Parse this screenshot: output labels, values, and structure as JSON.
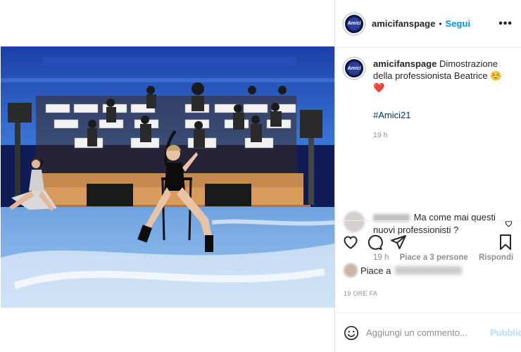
{
  "post": {
    "username": "amicifanspage",
    "follow_label": "Segui",
    "more_label": "•••",
    "avatar_text": "Amici"
  },
  "caption": {
    "username": "amicifanspage",
    "text": "Dimostrazione della professionista Beatrice ☺️❤️",
    "hashtag": "#Amici21",
    "time": "19 h"
  },
  "comment": {
    "text": "Ma come mai questi nuovi professionisti ?",
    "time": "19 h",
    "likes": "Piace a 3 persone",
    "reply": "Rispondi"
  },
  "likes": {
    "prefix": "Piace a"
  },
  "post_date": "19 ORE FA",
  "add_comment": {
    "placeholder": "Aggiungi un commento...",
    "publish": "Pubblica"
  },
  "icons": [
    "heart-icon",
    "comment-icon",
    "share-icon",
    "bookmark-icon",
    "emoji-icon",
    "more-icon"
  ]
}
